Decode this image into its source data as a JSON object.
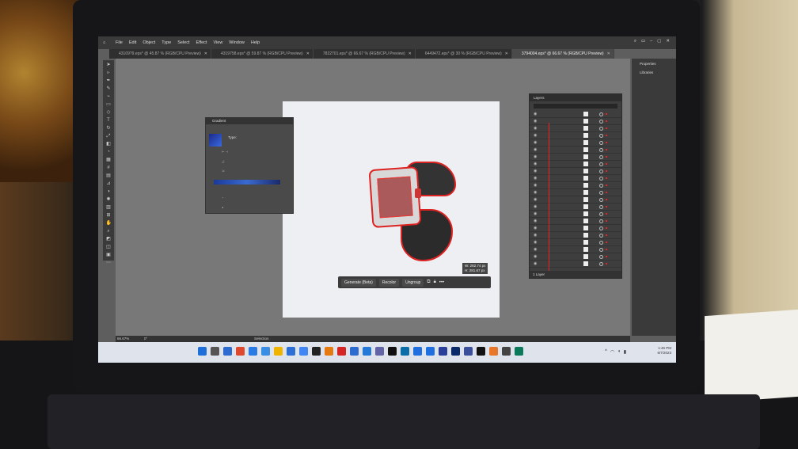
{
  "menubar": {
    "items": [
      "File",
      "Edit",
      "Object",
      "Type",
      "Select",
      "Effect",
      "View",
      "Window",
      "Help"
    ]
  },
  "tabs": [
    {
      "label": "43109?9.eps* @ 45.87 % (RGB/CPU Preview)",
      "active": false
    },
    {
      "label": "4319758.eps* @ 59.87 % (RGB/CPU Preview)",
      "active": false
    },
    {
      "label": "7822701.eps* @ 66.67 % (RGB/CPU Preview)",
      "active": false
    },
    {
      "label": "6449472.eps* @ 30 % (RGB/CPU Preview)",
      "active": false
    },
    {
      "label": "3794004.eps* @ 66.67 % (RGB/CPU Preview)",
      "active": true
    }
  ],
  "gradient_panel": {
    "title": "Gradient",
    "type_label": "Type:"
  },
  "context_bar": {
    "generate": "Generate (Beta)",
    "recolor": "Recolor",
    "ungroup": "Ungroup",
    "more": "•••"
  },
  "dimension_tip": {
    "w": "W: 282.74 px",
    "h": "H: 281.67 px"
  },
  "layers_panel": {
    "title": "Layers",
    "footer": "1 Layer",
    "row_count": 22
  },
  "right_panel": {
    "items": [
      "Properties",
      "Libraries"
    ]
  },
  "statusbar": {
    "zoom": "66.67%",
    "angle": "0°",
    "tool": "Selection"
  },
  "taskbar": {
    "time": "1:46 PM",
    "date": "6/7/2023"
  },
  "colors": {
    "accent": "#d22222",
    "gradient_start": "#1a2a8a",
    "gradient_end": "#3a6ae0"
  }
}
